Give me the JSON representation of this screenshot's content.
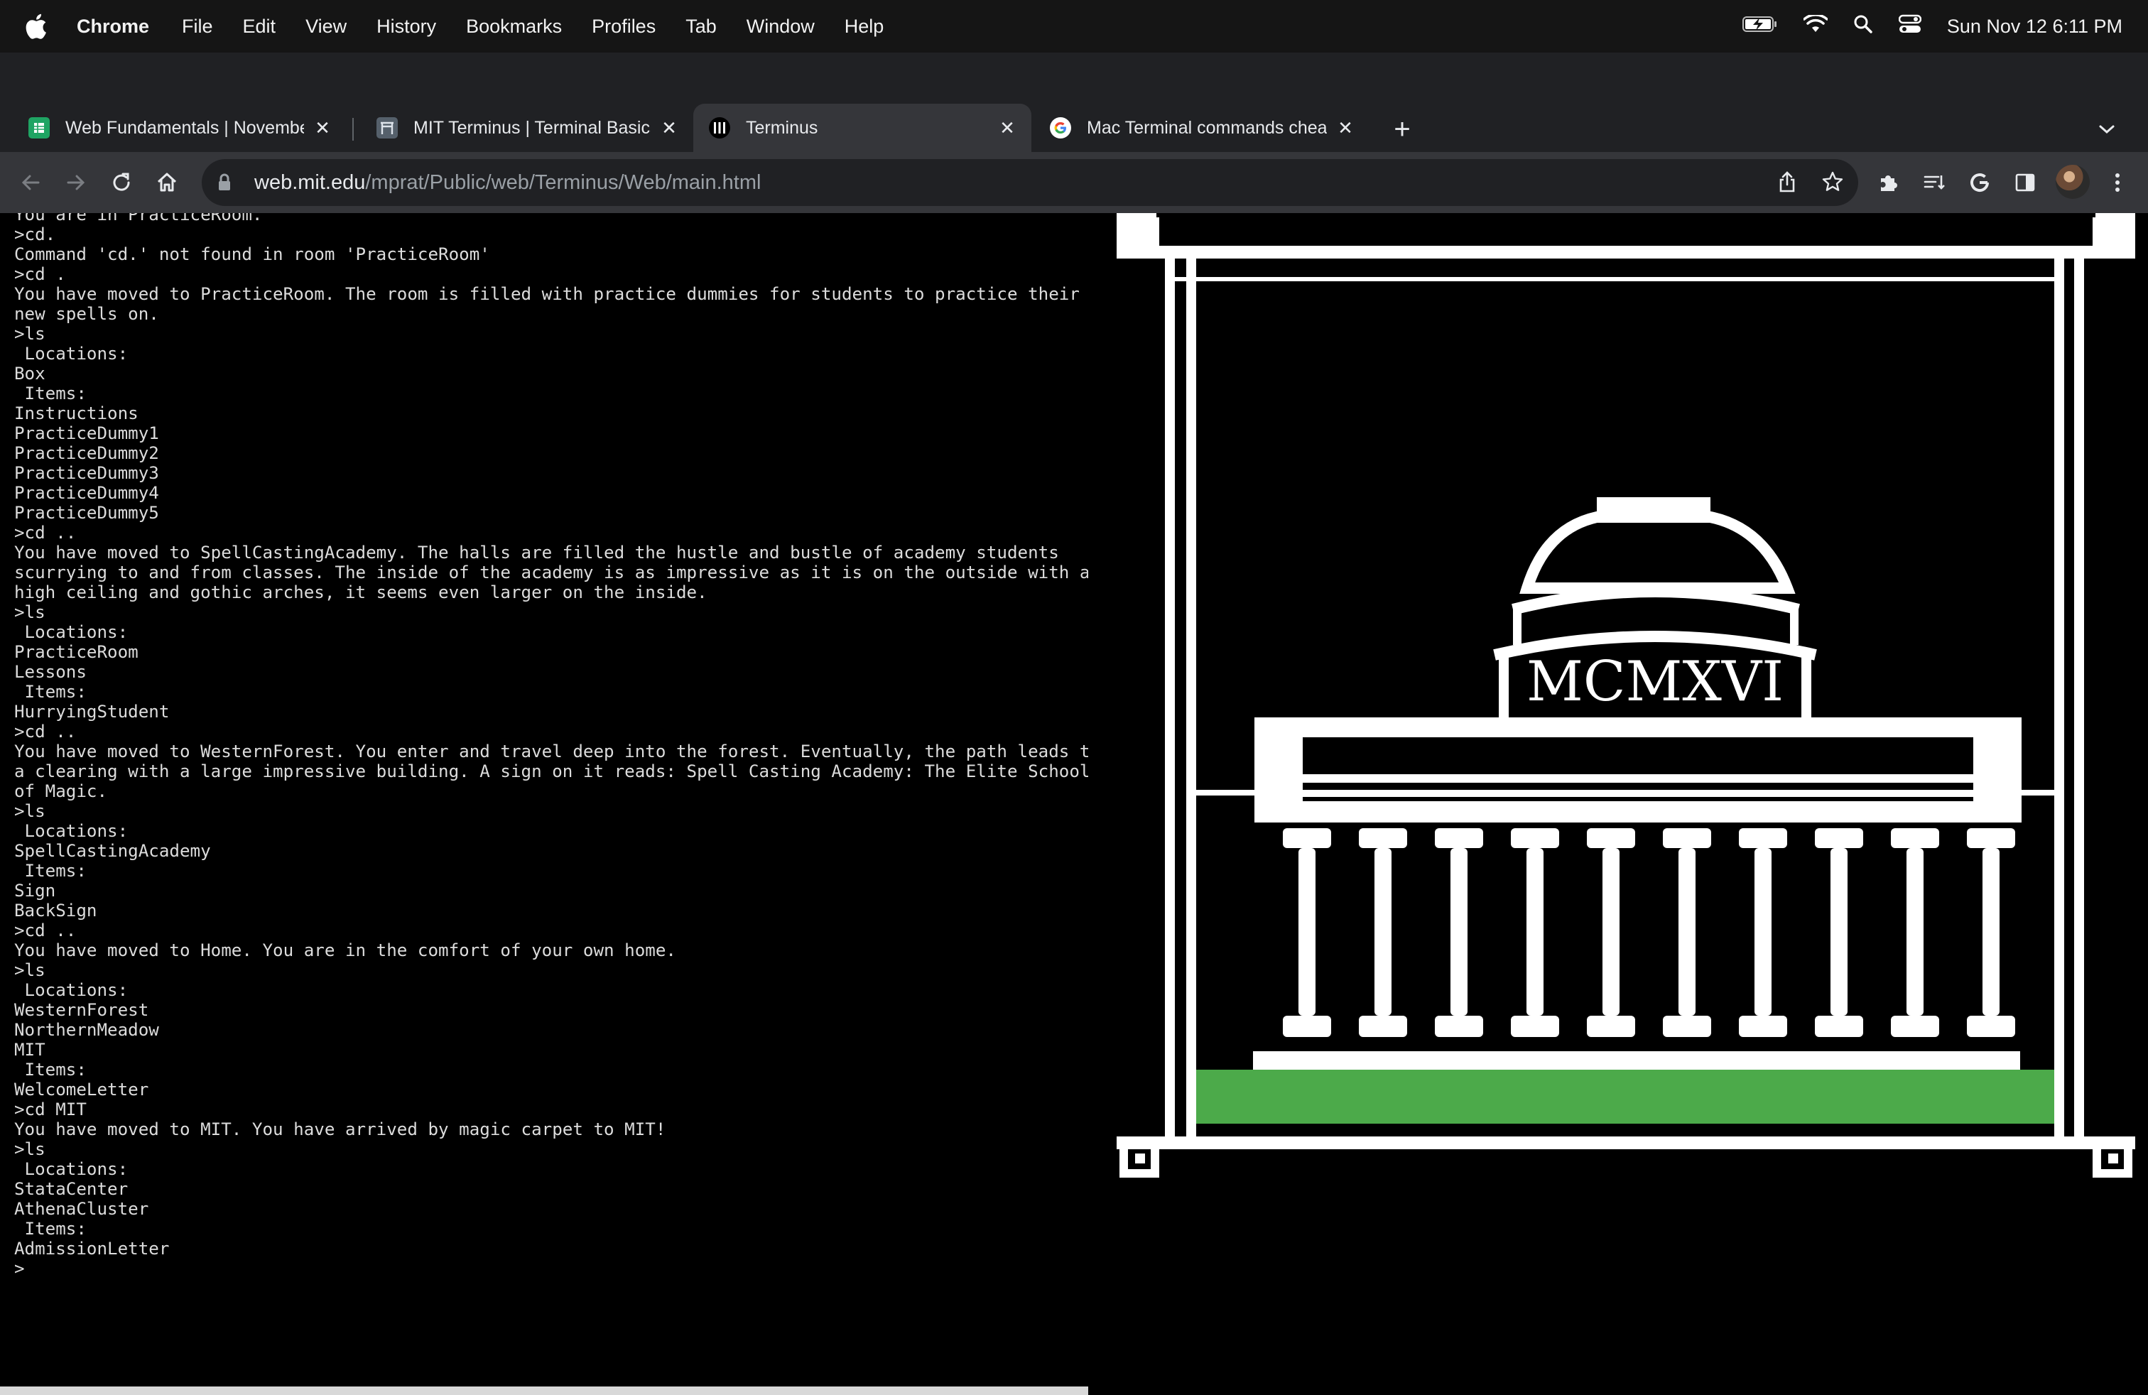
{
  "menubar": {
    "app_name": "Chrome",
    "items": [
      "File",
      "Edit",
      "View",
      "History",
      "Bookmarks",
      "Profiles",
      "Tab",
      "Window",
      "Help"
    ],
    "clock": "Sun Nov 12  6:11 PM",
    "icons": [
      "apple-icon",
      "battery-charging-icon",
      "wifi-icon",
      "spotlight-search-icon",
      "control-center-icon"
    ]
  },
  "tabs": [
    {
      "title": "Web Fundamentals | November",
      "favicon": "sheets-icon",
      "active": false
    },
    {
      "title": "MIT Terminus | Terminal Basics",
      "favicon": "mit-gate-icon",
      "active": false
    },
    {
      "title": "Terminus",
      "favicon": "terminus-icon",
      "active": true
    },
    {
      "title": "Mac Terminal commands cheat",
      "favicon": "google-icon",
      "active": false
    }
  ],
  "address": {
    "host": "web.mit.edu",
    "path": "/mprat/Public/web/Terminus/Web/main.html"
  },
  "terminal": {
    "lines": [
      "You are in PracticeRoom.",
      ">cd.",
      "Command 'cd.' not found in room 'PracticeRoom'",
      ">cd .",
      "You have moved to PracticeRoom. The room is filled with practice dummies for students to practice their",
      "new spells on.",
      ">ls",
      " Locations:",
      "Box",
      " Items:",
      "Instructions",
      "PracticeDummy1",
      "PracticeDummy2",
      "PracticeDummy3",
      "PracticeDummy4",
      "PracticeDummy5",
      ">cd ..",
      "You have moved to SpellCastingAcademy. The halls are filled the hustle and bustle of academy students",
      "scurrying to and from classes. The inside of the academy is as impressive as it is on the outside with a",
      "high ceiling and gothic arches, it seems even larger on the inside.",
      ">ls",
      " Locations:",
      "PracticeRoom",
      "Lessons",
      " Items:",
      "HurryingStudent",
      ">cd ..",
      "You have moved to WesternForest. You enter and travel deep into the forest. Eventually, the path leads to",
      "a clearing with a large impressive building. A sign on it reads: Spell Casting Academy: The Elite School",
      "of Magic.",
      ">ls",
      " Locations:",
      "SpellCastingAcademy",
      " Items:",
      "Sign",
      "BackSign",
      ">cd ..",
      "You have moved to Home. You are in the comfort of your own home.",
      ">ls",
      " Locations:",
      "WesternForest",
      "NorthernMeadow",
      "MIT",
      " Items:",
      "WelcomeLetter",
      ">cd MIT",
      "You have moved to MIT. You have arrived by magic carpet to MIT!",
      ">ls",
      " Locations:",
      "StataCenter",
      "AthenaCluster",
      " Items:",
      "AdmissionLetter",
      ">"
    ]
  },
  "picture": {
    "inscription": "MCMXVI",
    "colors": {
      "background": "#000000",
      "lines": "#ffffff",
      "lawn": "#4caa4a"
    }
  }
}
